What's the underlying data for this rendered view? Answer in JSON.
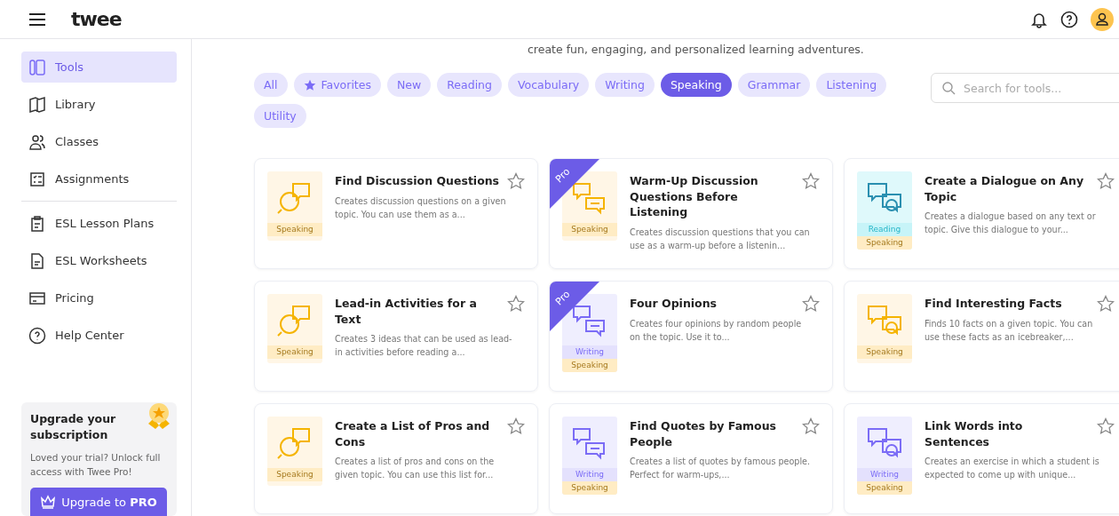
{
  "header": {
    "logo": "twee"
  },
  "sidebar": {
    "groups": [
      {
        "items": [
          {
            "label": "Tools",
            "selected": true
          },
          {
            "label": "Library",
            "selected": false
          },
          {
            "label": "Classes",
            "selected": false
          },
          {
            "label": "Assignments",
            "selected": false
          }
        ]
      },
      {
        "items": [
          {
            "label": "ESL Lesson Plans",
            "selected": false
          },
          {
            "label": "ESL Worksheets",
            "selected": false
          },
          {
            "label": "Pricing",
            "selected": false
          },
          {
            "label": "Help Center",
            "selected": false
          }
        ]
      }
    ],
    "upgrade": {
      "title": "Upgrade your subscription",
      "text": "Loved your trial? Unlock full access with Twee Pro!",
      "button": "Upgrade to **PRO**"
    }
  },
  "subtitle": "create fun, engaging, and personalized learning adventures.",
  "filters": [
    {
      "label": "All",
      "selected": false
    },
    {
      "label": "Favorites",
      "selected": false,
      "kind": "star"
    },
    {
      "label": "New",
      "selected": false
    },
    {
      "label": "Reading",
      "selected": false
    },
    {
      "label": "Vocabulary",
      "selected": false
    },
    {
      "label": "Writing",
      "selected": false
    },
    {
      "label": "Speaking",
      "selected": true
    },
    {
      "label": "Grammar",
      "selected": false
    },
    {
      "label": "Listening",
      "selected": false
    },
    {
      "label": "Utility",
      "selected": false
    }
  ],
  "search": {
    "placeholder": "Search for tools..."
  },
  "cards": [
    {
      "title": "Find Discussion Questions",
      "description": "Creates discussion questions on a given topic. You can use them as a...",
      "favorite": false,
      "tags": [
        {
          "label": "Speaking",
          "kind": "speaking"
        }
      ]
    },
    {
      "title": "Warm-Up Discussion Questions Before Listening",
      "description": "Creates discussion questions that you can use as a warm-up before a listenin...",
      "favorite": false,
      "ribbon": "Pro",
      "tags": [
        {
          "label": "Speaking",
          "kind": "speaking"
        }
      ]
    },
    {
      "title": "Create a Dialogue on Any Topic",
      "description": "Creates a dialogue based on any text or topic. Give this dialogue to your...",
      "favorite": false,
      "tags": [
        {
          "label": "Reading",
          "kind": "reading"
        },
        {
          "label": "Speaking",
          "kind": "speaking"
        }
      ]
    },
    {
      "title": "Lead-in Activities for a Text",
      "description": "Creates 3 ideas that can be used as lead-in activities before reading a...",
      "favorite": false,
      "tags": [
        {
          "label": "Speaking",
          "kind": "speaking"
        }
      ]
    },
    {
      "title": "Four Opinions",
      "description": "Creates four opinions by random people on the topic. Use it to...",
      "favorite": false,
      "ribbon": "Pro",
      "tags": [
        {
          "label": "Writing",
          "kind": "writing"
        },
        {
          "label": "Speaking",
          "kind": "speaking"
        }
      ]
    },
    {
      "title": "Find Interesting Facts",
      "description": "Finds 10 facts on a given topic. You can use these facts as an icebreaker,...",
      "favorite": false,
      "tags": [
        {
          "label": "Speaking",
          "kind": "speaking"
        }
      ]
    },
    {
      "title": "Create a List of Pros and Cons",
      "description": "Creates a list of pros and cons on the given topic. You can use this list for...",
      "favorite": false,
      "tags": [
        {
          "label": "Speaking",
          "kind": "speaking"
        }
      ]
    },
    {
      "title": "Find Quotes by Famous People",
      "description": "Creates a list of quotes by famous people. Perfect for warm-ups,...",
      "favorite": false,
      "tags": [
        {
          "label": "Writing",
          "kind": "writing"
        },
        {
          "label": "Speaking",
          "kind": "speaking"
        }
      ]
    },
    {
      "title": "Link Words into Sentences",
      "description": "Creates an exercise in which a student is expected to come up with unique...",
      "favorite": false,
      "tags": [
        {
          "label": "Writing",
          "kind": "writing"
        },
        {
          "label": "Speaking",
          "kind": "speaking"
        }
      ]
    }
  ]
}
